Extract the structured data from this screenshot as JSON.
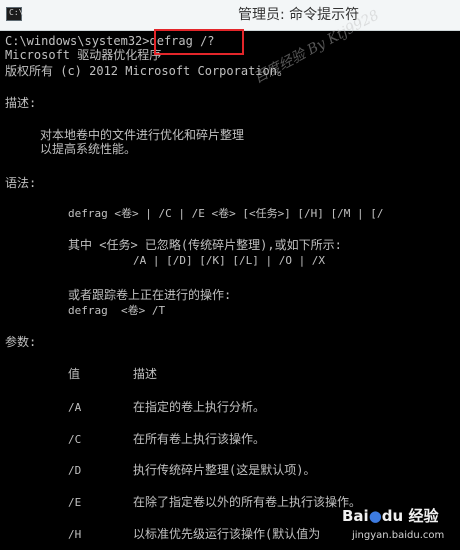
{
  "window": {
    "title": "管理员: 命令提示符",
    "icon": "cmd-icon",
    "icon_glyph": "C:\\"
  },
  "console": {
    "prompt": "C:\\windows\\system32>",
    "command": "defrag /?",
    "copyright1": "Microsoft 驱动器优化程序",
    "copyright2": "版权所有 (c) 2012 Microsoft Corporation。",
    "desc_header": "描述:",
    "desc1": "对本地卷中的文件进行优化和碎片整理",
    "desc2": "以提高系统性能。",
    "syntax_header": "语法:",
    "syntax1": "defrag <卷> | /C | /E <卷> [<任务>] [/H] [/M | [/",
    "syntax2": "其中 <任务> 已忽略(传统碎片整理),或如下所示:",
    "syntax3": "/A | [/D] [/K] [/L] | /O | /X",
    "syntax4": "或者跟踪卷上正在进行的操作:",
    "syntax5": "defrag  <卷> /T",
    "params_header": "参数:",
    "param_head_value": "值",
    "param_head_desc": "描述",
    "params": [
      {
        "flag": "/A",
        "desc": "在指定的卷上执行分析。"
      },
      {
        "flag": "/C",
        "desc": "在所有卷上执行该操作。"
      },
      {
        "flag": "/D",
        "desc": "执行传统碎片整理(这是默认项)。"
      },
      {
        "flag": "/E",
        "desc": "在除了指定卷以外的所有卷上执行该操作。"
      },
      {
        "flag": "/H",
        "desc": "以标准优先级运行该操作(默认值为"
      }
    ]
  },
  "watermark": {
    "text": "百度经验 By Ktj9928",
    "brand": "Bai",
    "brand_paw": "du",
    "brand_suffix": " 经验",
    "url": "jingyan.baidu.com"
  },
  "colors": {
    "console_bg": "#000000",
    "console_text": "#c0c0c0",
    "highlight": "#e3262a",
    "titlebar": "#f3f6f7"
  }
}
